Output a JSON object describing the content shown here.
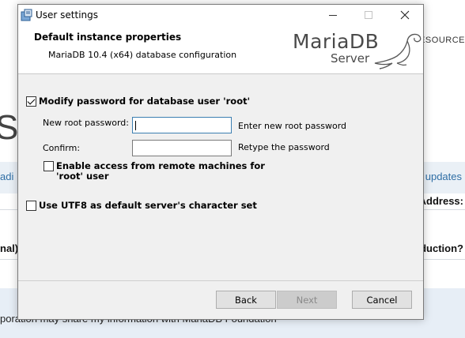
{
  "background_page": {
    "resources_text": "ESOURCE",
    "big_letter": "S",
    "left_link": "adi",
    "right_link": "updates",
    "address_label": "Address:",
    "left_question": "nal):",
    "right_question": "duction?",
    "footer_text": "poration may share my information with MariaDB Foundation"
  },
  "window": {
    "title": "User settings",
    "icon": "installer-icon",
    "controls": {
      "minimize": "minimize-icon",
      "maximize": "maximize-icon",
      "close": "close-icon"
    }
  },
  "header": {
    "title": "Default instance properties",
    "subtitle": "MariaDB 10.4 (x64) database configuration",
    "logo_brand": "MariaDB",
    "logo_product": "Server"
  },
  "form": {
    "modify_password": {
      "label": "Modify password for database user 'root'",
      "checked": true
    },
    "new_password": {
      "label": "New root password:",
      "value": "",
      "hint": "Enter new root password"
    },
    "confirm_password": {
      "label": "Confirm:",
      "value": "",
      "hint": "Retype the password"
    },
    "remote_access": {
      "label": "Enable access from remote machines for 'root' user",
      "checked": false
    },
    "utf8": {
      "label": "Use UTF8 as default server's character set",
      "checked": false
    }
  },
  "buttons": {
    "back": "Back",
    "next": "Next",
    "cancel": "Cancel"
  }
}
